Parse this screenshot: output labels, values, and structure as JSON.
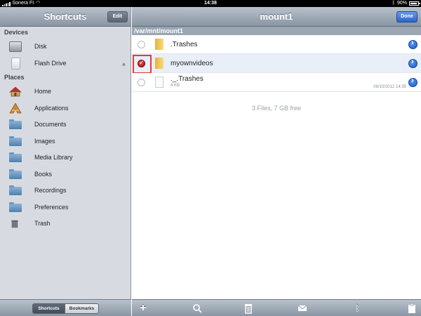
{
  "status_bar": {
    "carrier": "Sonera FI",
    "time": "14:38",
    "battery_percent": "90%",
    "battery_level": 0.9
  },
  "left_pane": {
    "title": "Shortcuts",
    "edit_label": "Edit",
    "devices_header": "Devices",
    "devices": [
      {
        "label": "Disk",
        "icon": "disk-icon"
      },
      {
        "label": "Flash Drive",
        "icon": "flash-drive-icon",
        "eject": true
      }
    ],
    "places_header": "Places",
    "places": [
      {
        "label": "Home",
        "icon": "home-icon"
      },
      {
        "label": "Applications",
        "icon": "applications-icon"
      },
      {
        "label": "Documents",
        "icon": "folder-icon"
      },
      {
        "label": "Images",
        "icon": "folder-icon"
      },
      {
        "label": "Media Library",
        "icon": "folder-icon"
      },
      {
        "label": "Books",
        "icon": "folder-icon"
      },
      {
        "label": "Recordings",
        "icon": "folder-icon"
      },
      {
        "label": "Preferences",
        "icon": "folder-icon"
      },
      {
        "label": "Trash",
        "icon": "trash-icon"
      }
    ],
    "segments": {
      "shortcuts": "Shortcuts",
      "bookmarks": "Bookmarks",
      "active": "Shortcuts"
    }
  },
  "right_pane": {
    "title": "mount1",
    "done_label": "Done",
    "path": "/var/mnt/mount1",
    "files": [
      {
        "name": ".Trashes",
        "type": "folder",
        "selected": false
      },
      {
        "name": "myownvideos",
        "type": "folder",
        "selected": true
      },
      {
        "name": "._.Trashes",
        "type": "file",
        "size": "4 KB",
        "date": "08/10/2012 14:35",
        "selected": false
      }
    ],
    "summary": "3 Files, 7 GB free",
    "toolbar": [
      "add-icon",
      "search-icon",
      "trash-icon",
      "mail-icon",
      "bluetooth-icon",
      "clipboard-icon"
    ]
  },
  "colors": {
    "bar_gradient_top": "#b9c2cc",
    "bar_gradient_bottom": "#8995a3",
    "sidebar_bg": "#d7dbe1",
    "done_blue": "#2d64c8",
    "highlight_red": "#e53935"
  }
}
